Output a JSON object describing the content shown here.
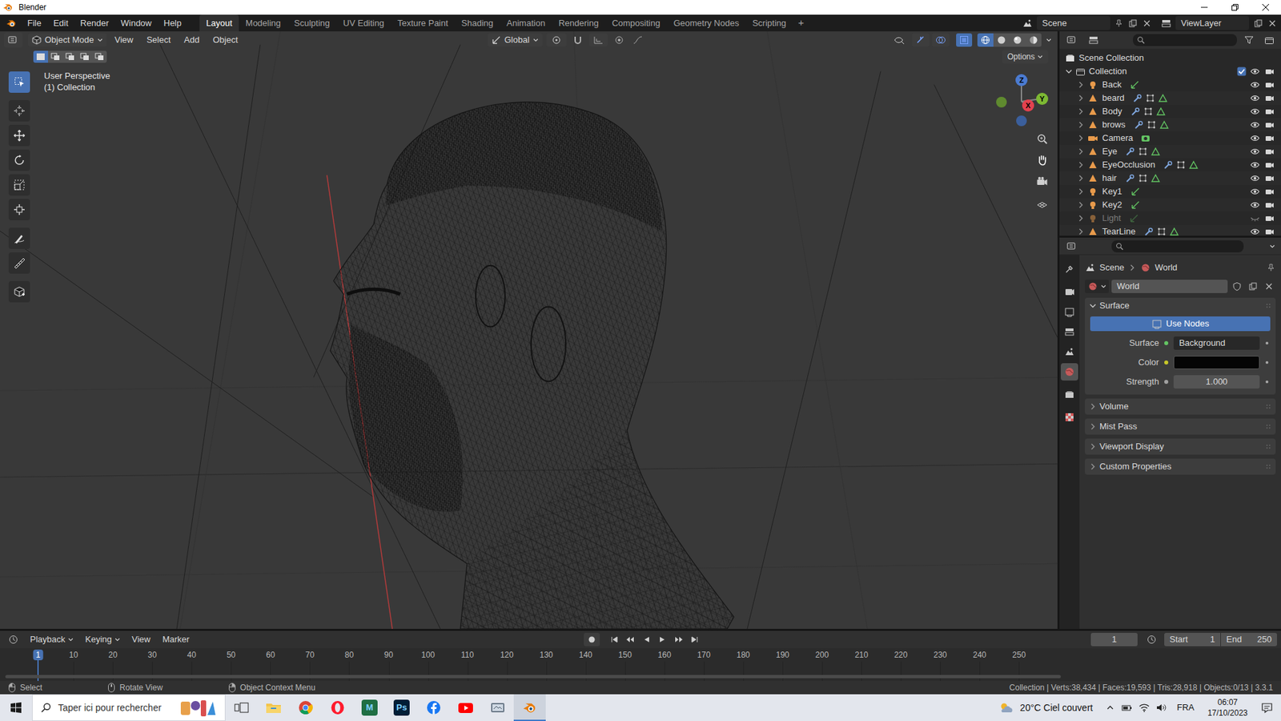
{
  "window": {
    "title": "Blender"
  },
  "topbar": {
    "menus": [
      "File",
      "Edit",
      "Render",
      "Window",
      "Help"
    ],
    "workspaces": [
      {
        "label": "Layout",
        "selected": true
      },
      {
        "label": "Modeling",
        "selected": false
      },
      {
        "label": "Sculpting",
        "selected": false
      },
      {
        "label": "UV Editing",
        "selected": false
      },
      {
        "label": "Texture Paint",
        "selected": false
      },
      {
        "label": "Shading",
        "selected": false
      },
      {
        "label": "Animation",
        "selected": false
      },
      {
        "label": "Rendering",
        "selected": false
      },
      {
        "label": "Compositing",
        "selected": false
      },
      {
        "label": "Geometry Nodes",
        "selected": false
      },
      {
        "label": "Scripting",
        "selected": false
      }
    ],
    "add_tab": "+",
    "scene": "Scene",
    "view_layer": "ViewLayer"
  },
  "viewport": {
    "mode": "Object Mode",
    "menus": [
      "View",
      "Select",
      "Add",
      "Object"
    ],
    "orientation": "Global",
    "options": "Options",
    "overlay_title": "User Perspective",
    "overlay_collection": "(1) Collection",
    "select_modes": [
      {
        "selected": true
      },
      {
        "selected": false
      },
      {
        "selected": false
      },
      {
        "selected": false
      },
      {
        "selected": false
      }
    ],
    "shading": [
      {
        "selected": true
      },
      {
        "selected": false
      },
      {
        "selected": false
      },
      {
        "selected": false
      }
    ],
    "tools": [
      {
        "selected": true
      },
      {
        "selected": false
      },
      {
        "selected": false
      },
      {
        "selected": false
      },
      {
        "selected": false
      },
      {
        "selected": false
      },
      {
        "selected": false
      },
      {
        "selected": false
      },
      {
        "selected": false
      }
    ],
    "gizmo": {
      "z": "Z",
      "y": "Y",
      "x": "X"
    }
  },
  "outliner": {
    "root": "Scene Collection",
    "collection": {
      "name": "Collection",
      "checked": true
    },
    "items": [
      {
        "name": "Back",
        "kind": "light",
        "visible": true
      },
      {
        "name": "beard",
        "kind": "mesh",
        "visible": true
      },
      {
        "name": "Body",
        "kind": "mesh",
        "visible": true
      },
      {
        "name": "brows",
        "kind": "mesh",
        "visible": true
      },
      {
        "name": "Camera",
        "kind": "camera",
        "visible": true
      },
      {
        "name": "Eye",
        "kind": "mesh",
        "visible": true
      },
      {
        "name": "EyeOcclusion",
        "kind": "mesh",
        "visible": true
      },
      {
        "name": "hair",
        "kind": "mesh",
        "visible": true
      },
      {
        "name": "Key1",
        "kind": "light",
        "visible": true
      },
      {
        "name": "Key2",
        "kind": "light",
        "visible": true
      },
      {
        "name": "Light",
        "kind": "light",
        "visible": false
      },
      {
        "name": "TearLine",
        "kind": "mesh",
        "visible": true
      }
    ]
  },
  "properties": {
    "tabs": [
      {
        "selected": false
      },
      {
        "selected": false
      },
      {
        "selected": false
      },
      {
        "selected": false
      },
      {
        "selected": false
      },
      {
        "selected": true
      },
      {
        "selected": false
      },
      {
        "selected": false
      }
    ],
    "breadcrumb": [
      "Scene",
      "World"
    ],
    "world": "World",
    "surface_panel": {
      "title": "Surface",
      "expanded": true
    },
    "use_nodes": {
      "label": "Use Nodes",
      "on": true
    },
    "fields": [
      {
        "label": "Surface",
        "value": "Background",
        "kind": "shader"
      },
      {
        "label": "Color",
        "kind": "color"
      },
      {
        "label": "Strength",
        "value": "1.000",
        "kind": "number"
      }
    ],
    "panels": [
      {
        "title": "Volume",
        "expanded": false
      },
      {
        "title": "Mist Pass",
        "expanded": false
      },
      {
        "title": "Viewport Display",
        "expanded": false
      },
      {
        "title": "Custom Properties",
        "expanded": false
      }
    ]
  },
  "timeline": {
    "menus": [
      "Playback",
      "Keying",
      "View",
      "Marker"
    ],
    "current_frame": "1",
    "start_label": "Start",
    "start": "1",
    "end_label": "End",
    "end": "250",
    "ticks": [
      {
        "label": "1",
        "selected": true
      },
      {
        "label": "10",
        "selected": false
      },
      {
        "label": "20",
        "selected": false
      },
      {
        "label": "30",
        "selected": false
      },
      {
        "label": "40",
        "selected": false
      },
      {
        "label": "50",
        "selected": false
      },
      {
        "label": "60",
        "selected": false
      },
      {
        "label": "70",
        "selected": false
      },
      {
        "label": "80",
        "selected": false
      },
      {
        "label": "90",
        "selected": false
      },
      {
        "label": "100",
        "selected": false
      },
      {
        "label": "110",
        "selected": false
      },
      {
        "label": "120",
        "selected": false
      },
      {
        "label": "130",
        "selected": false
      },
      {
        "label": "140",
        "selected": false
      },
      {
        "label": "150",
        "selected": false
      },
      {
        "label": "160",
        "selected": false
      },
      {
        "label": "170",
        "selected": false
      },
      {
        "label": "180",
        "selected": false
      },
      {
        "label": "190",
        "selected": false
      },
      {
        "label": "200",
        "selected": false
      },
      {
        "label": "210",
        "selected": false
      },
      {
        "label": "220",
        "selected": false
      },
      {
        "label": "230",
        "selected": false
      },
      {
        "label": "240",
        "selected": false
      },
      {
        "label": "250",
        "selected": false
      }
    ]
  },
  "status_bar": {
    "hints": [
      "Select",
      "Rotate View",
      "Object Context Menu"
    ],
    "stats": "Collection | Verts:38,434 | Faces:19,593 | Tris:28,918 | Objects:0/13 | 3.3.1"
  },
  "taskbar": {
    "search": {
      "placeholder": "Taper ici pour rechercher"
    },
    "apps": [
      {
        "kind": "taskview",
        "selected": false
      },
      {
        "kind": "explorer",
        "selected": false
      },
      {
        "kind": "chrome",
        "selected": false
      },
      {
        "kind": "opera",
        "selected": false
      },
      {
        "kind": "letter",
        "label": "M",
        "color": "#1f6e43",
        "selected": false
      },
      {
        "kind": "letter",
        "label": "Ps",
        "color": "#001e36",
        "selected": false
      },
      {
        "kind": "facebook",
        "selected": false
      },
      {
        "kind": "youtube",
        "selected": false
      },
      {
        "kind": "generic",
        "selected": false
      },
      {
        "kind": "blender",
        "selected": true
      }
    ],
    "weather": "20°C Ciel couvert",
    "language": "FRA",
    "time": "06:07",
    "date": "17/10/2023"
  }
}
